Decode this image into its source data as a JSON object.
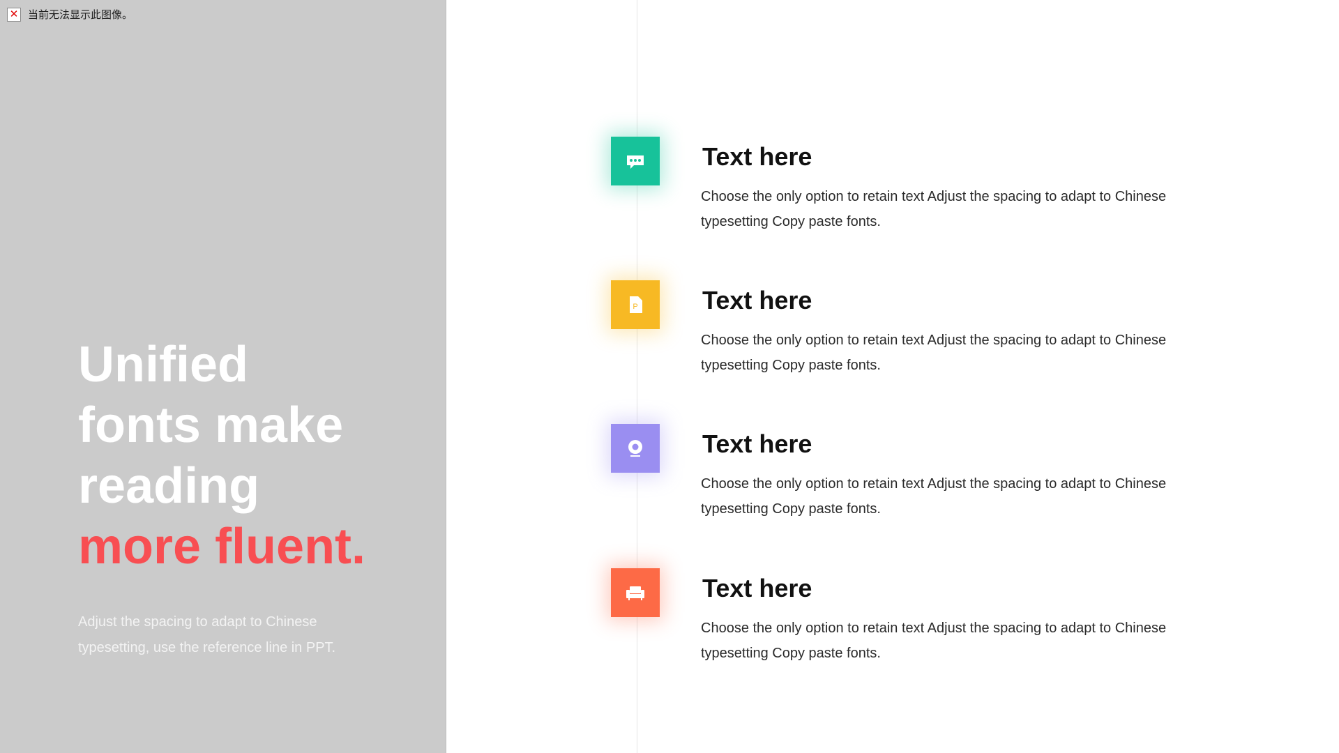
{
  "left_panel": {
    "broken_image_text": "当前无法显示此图像。",
    "headline_lines": [
      "Unified",
      "fonts make",
      "reading"
    ],
    "headline_accent": "more fluent.",
    "accent_color": "#f84e52",
    "subtitle": "Adjust the spacing to adapt to Chinese typesetting, use the reference line in PPT."
  },
  "timeline": {
    "items": [
      {
        "icon": "chat-bubble-icon",
        "color": "#17c29a",
        "title": "Text here",
        "body": "Choose the only option to retain text Adjust the spacing to adapt to Chinese typesetting Copy paste fonts."
      },
      {
        "icon": "ppt-file-icon",
        "color": "#f7b924",
        "title": "Text here",
        "body": "Choose the only option to retain text Adjust the spacing to adapt to Chinese typesetting Copy paste fonts."
      },
      {
        "icon": "webcam-icon",
        "color": "#9a8ef1",
        "title": "Text here",
        "body": "Choose the only option to retain text Adjust the spacing to adapt to Chinese typesetting Copy paste fonts."
      },
      {
        "icon": "sofa-icon",
        "color": "#fd6a46",
        "title": "Text here",
        "body": "Choose the only option to retain text Adjust the spacing to adapt to Chinese typesetting Copy paste fonts."
      }
    ]
  }
}
